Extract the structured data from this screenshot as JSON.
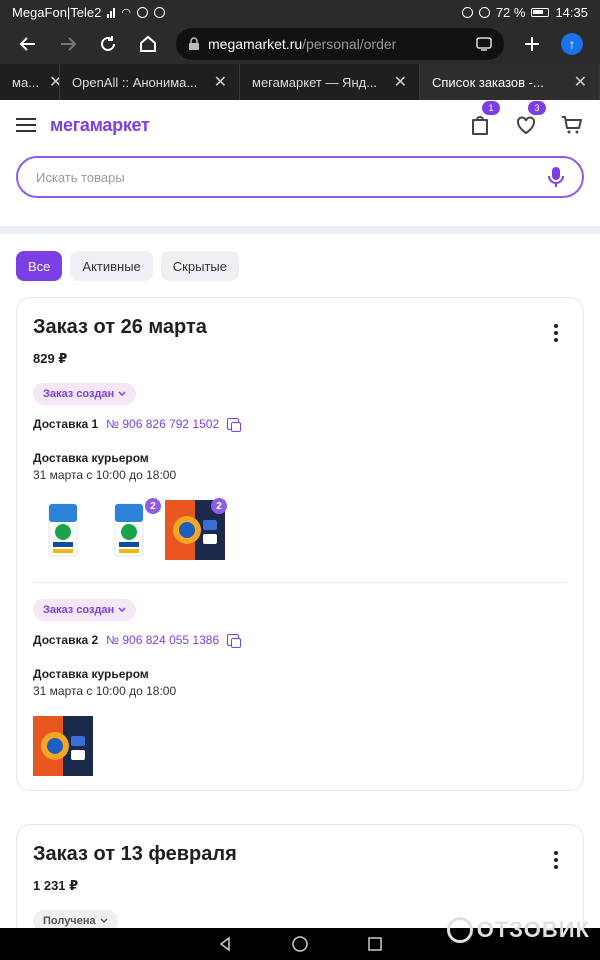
{
  "status_bar": {
    "carrier": "MegaFon|Tele2",
    "battery": "72 %",
    "time": "14:35"
  },
  "browser": {
    "url_domain": "megamarket.ru",
    "url_path": "/personal/order",
    "tabs": [
      {
        "title": "ма..."
      },
      {
        "title": "OpenAll :: Анонима..."
      },
      {
        "title": "мегамаркет — Янд..."
      },
      {
        "title": "Список заказов -..."
      }
    ]
  },
  "site": {
    "logo": "мегамаркет",
    "cart_badge": "1",
    "favorites_badge": "3",
    "search_placeholder": "Искать товары"
  },
  "filters": [
    {
      "label": "Все",
      "active": true
    },
    {
      "label": "Активные",
      "active": false
    },
    {
      "label": "Скрытые",
      "active": false
    }
  ],
  "orders": [
    {
      "title": "Заказ от 26 марта",
      "sum": "829 ₽",
      "deliveries": [
        {
          "status": "Заказ создан",
          "label": "Доставка 1",
          "number": "№ 906 826 792 1502",
          "method": "Доставка курьером",
          "slot": "31 марта с 10:00 до 18:00",
          "products": [
            {
              "name": "ariel-powder",
              "badge": ""
            },
            {
              "name": "ariel-powder",
              "badge": "2"
            },
            {
              "name": "tide-capsules",
              "badge": "2"
            }
          ]
        },
        {
          "status": "Заказ создан",
          "label": "Доставка 2",
          "number": "№ 906 824 055 1386",
          "method": "Доставка курьером",
          "slot": "31 марта с 10:00 до 18:00",
          "products": [
            {
              "name": "tide-capsules",
              "badge": ""
            }
          ]
        }
      ]
    },
    {
      "title": "Заказ от 13 февраля",
      "sum": "1 231 ₽",
      "status": "Получена"
    }
  ],
  "watermark": "ОТЗОВИК",
  "colors": {
    "brand": "#7b3fe4",
    "status_bg": "#f4e7f6"
  }
}
